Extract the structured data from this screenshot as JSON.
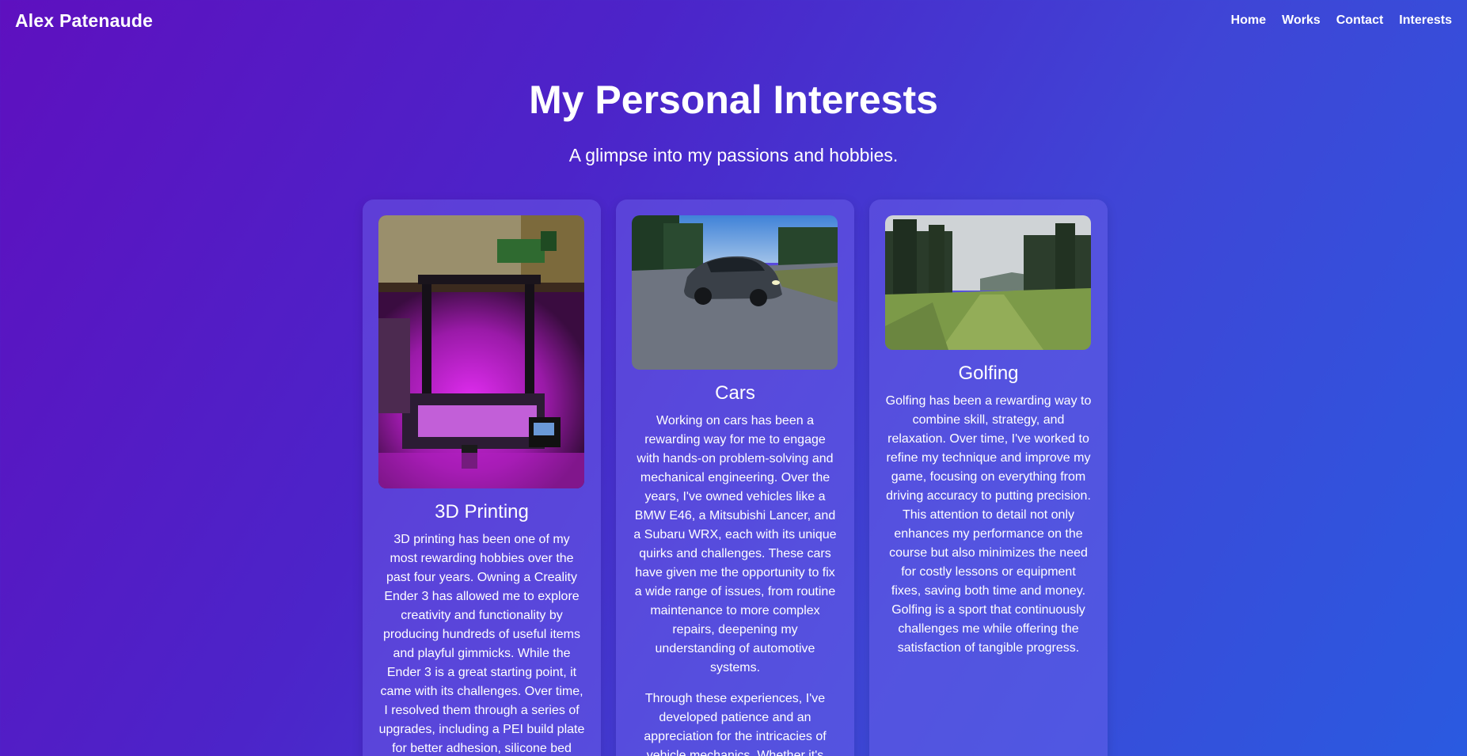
{
  "nav": {
    "brand": "Alex Patenaude",
    "links": [
      "Home",
      "Works",
      "Contact",
      "Interests"
    ]
  },
  "hero": {
    "title": "My Personal Interests",
    "subtitle": "A glimpse into my passions and hobbies."
  },
  "cards": [
    {
      "title": "3D Printing",
      "image": "3d-printer-photo",
      "paragraphs": [
        "3D printing has been one of my most rewarding hobbies over the past four years. Owning a Creality Ender 3 has allowed me to explore creativity and functionality by producing hundreds of useful items and playful gimmicks. While the Ender 3 is a great starting point, it came with its challenges. Over time, I resolved them through a series of upgrades, including a PEI build plate for better adhesion, silicone bed"
      ]
    },
    {
      "title": "Cars",
      "image": "car-photo",
      "paragraphs": [
        "Working on cars has been a rewarding way for me to engage with hands-on problem-solving and mechanical engineering. Over the years, I've owned vehicles like a BMW E46, a Mitsubishi Lancer, and a Subaru WRX, each with its unique quirks and challenges. These cars have given me the opportunity to fix a wide range of issues, from routine maintenance to more complex repairs, deepening my understanding of automotive systems.",
        "Through these experiences, I've developed patience and an appreciation for the intricacies of vehicle mechanics. Whether it's"
      ]
    },
    {
      "title": "Golfing",
      "image": "golf-course-photo",
      "paragraphs": [
        "Golfing has been a rewarding way to combine skill, strategy, and relaxation. Over time, I've worked to refine my technique and improve my game, focusing on everything from driving accuracy to putting precision. This attention to detail not only enhances my performance on the course but also minimizes the need for costly lessons or equipment fixes, saving both time and money. Golfing is a sport that continuously challenges me while offering the satisfaction of tangible progress."
      ]
    }
  ]
}
